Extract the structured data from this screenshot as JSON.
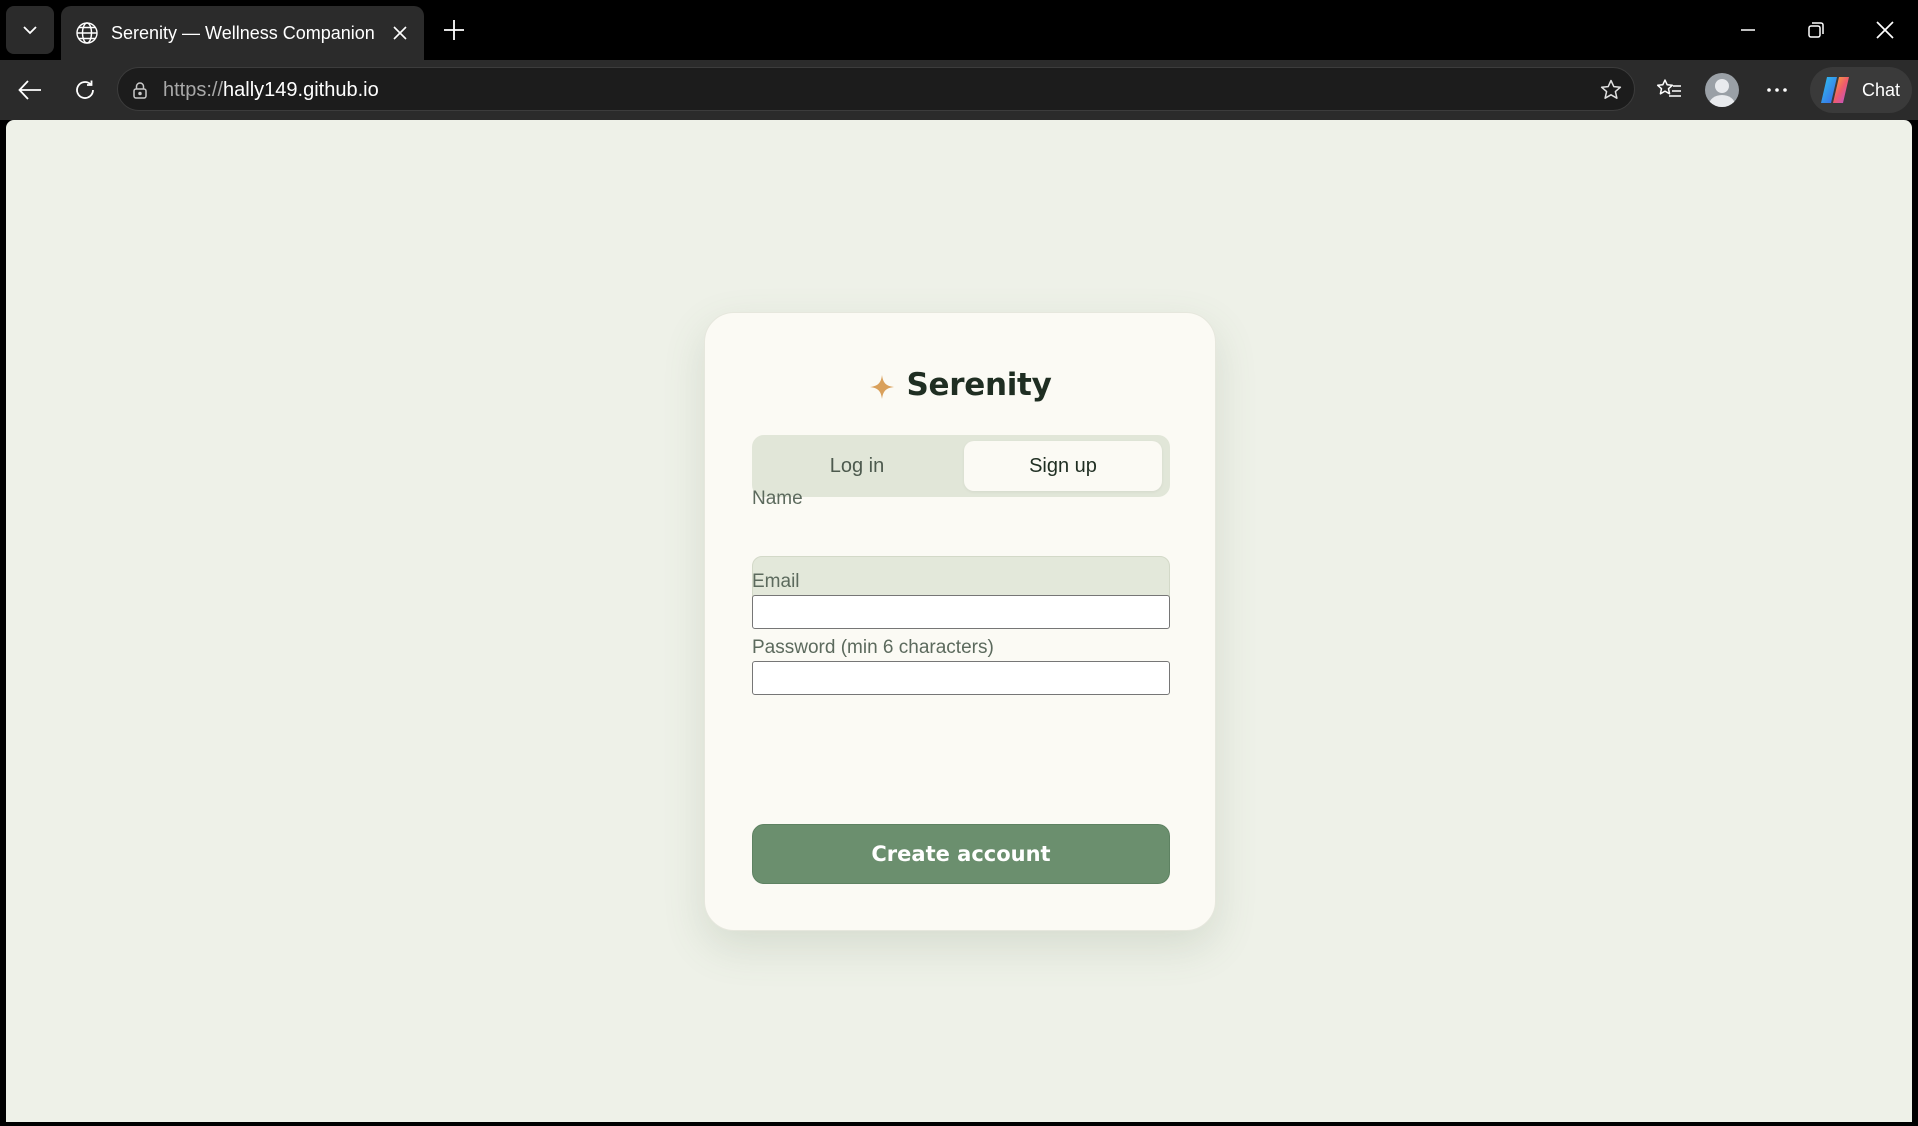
{
  "browser": {
    "tab_title": "Serenity — Wellness Companion",
    "url_protocol": "https://",
    "url_host": "hally149.github.io",
    "chat_label": "Chat"
  },
  "app": {
    "brand_name": "Serenity",
    "accent_color": "#d9a05b",
    "primary_color": "#6b8f6e",
    "tabs": [
      {
        "label": "Log in",
        "active": false
      },
      {
        "label": "Sign up",
        "active": true
      }
    ],
    "form": {
      "name_label": "Name",
      "name_value": "",
      "email_label": "Email",
      "email_value": "",
      "password_label": "Password (min 6 characters)",
      "password_value": "",
      "submit_label": "Create account"
    }
  },
  "icons": [
    "tab-list-icon",
    "globe-icon",
    "close-icon",
    "plus-icon",
    "minimize-icon",
    "restore-icon",
    "back-icon",
    "reload-icon",
    "lock-icon",
    "star-icon",
    "favorites-icon",
    "more-icon",
    "copilot-icon",
    "sparkle-icon"
  ]
}
